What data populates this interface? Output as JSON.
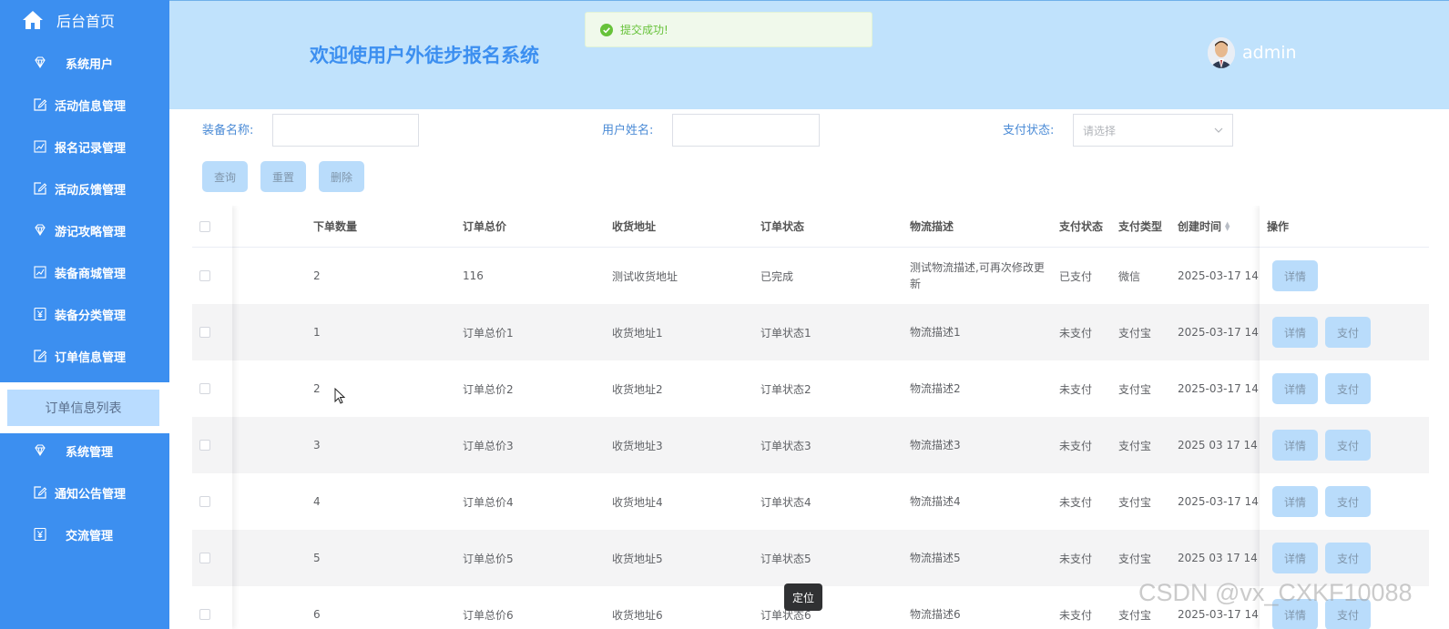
{
  "sidebar": {
    "home": {
      "label": "后台首页",
      "icon": "home-icon"
    },
    "items": [
      {
        "label": "系统用户",
        "icon": "diamond-icon",
        "center": true
      },
      {
        "label": "活动信息管理",
        "icon": "edit-icon"
      },
      {
        "label": "报名记录管理",
        "icon": "chart-icon"
      },
      {
        "label": "活动反馈管理",
        "icon": "edit-icon"
      },
      {
        "label": "游记攻略管理",
        "icon": "diamond-icon"
      },
      {
        "label": "装备商城管理",
        "icon": "chart-icon"
      },
      {
        "label": "装备分类管理",
        "icon": "yen-icon"
      },
      {
        "label": "订单信息管理",
        "icon": "edit-icon"
      }
    ],
    "active_sub": "订单信息列表",
    "items_after": [
      {
        "label": "系统管理",
        "icon": "diamond-icon",
        "center": true
      },
      {
        "label": "通知公告管理",
        "icon": "edit-icon"
      },
      {
        "label": "交流管理",
        "icon": "yen-icon",
        "center": true
      }
    ]
  },
  "header": {
    "title": "欢迎使用户外徒步报名系统",
    "username": "admin"
  },
  "toast": {
    "message": "提交成功!"
  },
  "search": {
    "equipment_label": "装备名称:",
    "equipment_value": "",
    "username_label": "用户姓名:",
    "username_value": "",
    "pay_status_label": "支付状态:",
    "pay_status_placeholder": "请选择",
    "buttons": {
      "query": "查询",
      "reset": "重置",
      "delete": "删除"
    }
  },
  "table": {
    "columns": [
      "下单数量",
      "订单总价",
      "收货地址",
      "订单状态",
      "物流描述",
      "支付状态",
      "支付类型",
      "创建时间",
      "操作"
    ],
    "rows": [
      {
        "qty": "2",
        "total": "116",
        "address": "测试收货地址",
        "status": "已完成",
        "logistics": "测试物流描述,可再次修改更新",
        "pay_status": "已支付",
        "pay_type": "微信",
        "created": "2025-03-17 14",
        "actions": [
          "详情"
        ]
      },
      {
        "qty": "1",
        "total": "订单总价1",
        "address": "收货地址1",
        "status": "订单状态1",
        "logistics": "物流描述1",
        "pay_status": "未支付",
        "pay_type": "支付宝",
        "created": "2025-03-17 14",
        "actions": [
          "详情",
          "支付"
        ]
      },
      {
        "qty": "2",
        "total": "订单总价2",
        "address": "收货地址2",
        "status": "订单状态2",
        "logistics": "物流描述2",
        "pay_status": "未支付",
        "pay_type": "支付宝",
        "created": "2025-03-17 14",
        "actions": [
          "详情",
          "支付"
        ]
      },
      {
        "qty": "3",
        "total": "订单总价3",
        "address": "收货地址3",
        "status": "订单状态3",
        "logistics": "物流描述3",
        "pay_status": "未支付",
        "pay_type": "支付宝",
        "created": "2025 03 17 14",
        "actions": [
          "详情",
          "支付"
        ]
      },
      {
        "qty": "4",
        "total": "订单总价4",
        "address": "收货地址4",
        "status": "订单状态4",
        "logistics": "物流描述4",
        "pay_status": "未支付",
        "pay_type": "支付宝",
        "created": "2025-03-17 14",
        "actions": [
          "详情",
          "支付"
        ]
      },
      {
        "qty": "5",
        "total": "订单总价5",
        "address": "收货地址5",
        "status": "订单状态5",
        "logistics": "物流描述5",
        "pay_status": "未支付",
        "pay_type": "支付宝",
        "created": "2025 03 17 14",
        "actions": [
          "详情",
          "支付"
        ]
      },
      {
        "qty": "6",
        "total": "订单总价6",
        "address": "收货地址6",
        "status": "订单状态6",
        "logistics": "物流描述6",
        "pay_status": "未支付",
        "pay_type": "支付宝",
        "created": "2025-03-17 14",
        "actions": [
          "详情",
          "支付"
        ]
      }
    ]
  },
  "tooltip": "定位",
  "watermark": "CSDN @vx_CXKF10088",
  "colors": {
    "sidebar": "#3c8ff0",
    "header": "#c0e2fc",
    "button": "#b9dcfb",
    "toast_text": "#67c23a"
  }
}
